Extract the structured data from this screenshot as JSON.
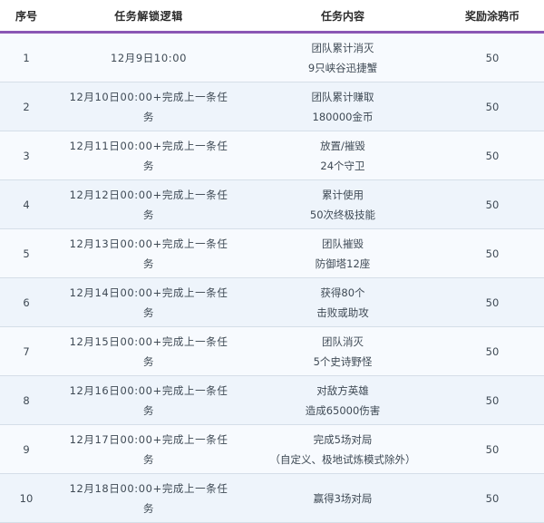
{
  "header": {
    "col_index": "序号",
    "col_unlock": "任务解锁逻辑",
    "col_content": "任务内容",
    "col_reward": "奖励涂鸦币"
  },
  "rows": [
    {
      "index": "1",
      "unlock": "12月9日10:00",
      "content": "团队累计消灭\n9只峡谷迅捷蟹",
      "reward": "50"
    },
    {
      "index": "2",
      "unlock": "12月10日00:00+完成上一条任\n务",
      "content": "团队累计赚取\n180000金币",
      "reward": "50"
    },
    {
      "index": "3",
      "unlock": "12月11日00:00+完成上一条任\n务",
      "content": "放置/摧毁\n24个守卫",
      "reward": "50"
    },
    {
      "index": "4",
      "unlock": "12月12日00:00+完成上一条任\n务",
      "content": "累计使用\n50次终极技能",
      "reward": "50"
    },
    {
      "index": "5",
      "unlock": "12月13日00:00+完成上一条任\n务",
      "content": "团队摧毁\n防御塔12座",
      "reward": "50"
    },
    {
      "index": "6",
      "unlock": "12月14日00:00+完成上一条任\n务",
      "content": "获得80个\n击败或助攻",
      "reward": "50"
    },
    {
      "index": "7",
      "unlock": "12月15日00:00+完成上一条任\n务",
      "content": "团队消灭\n5个史诗野怪",
      "reward": "50"
    },
    {
      "index": "8",
      "unlock": "12月16日00:00+完成上一条任\n务",
      "content": "对敌方英雄\n造成65000伤害",
      "reward": "50"
    },
    {
      "index": "9",
      "unlock": "12月17日00:00+完成上一条任\n务",
      "content": "完成5场对局\n（自定义、极地试炼模式除外）",
      "reward": "50"
    },
    {
      "index": "10",
      "unlock": "12月18日00:00+完成上一条任\n务",
      "content": "赢得3场对局\n",
      "reward": "50"
    }
  ],
  "colors": {
    "accent": "#8a56b4",
    "row_alt": "#f7fafe",
    "row_base": "#eef4fb"
  }
}
